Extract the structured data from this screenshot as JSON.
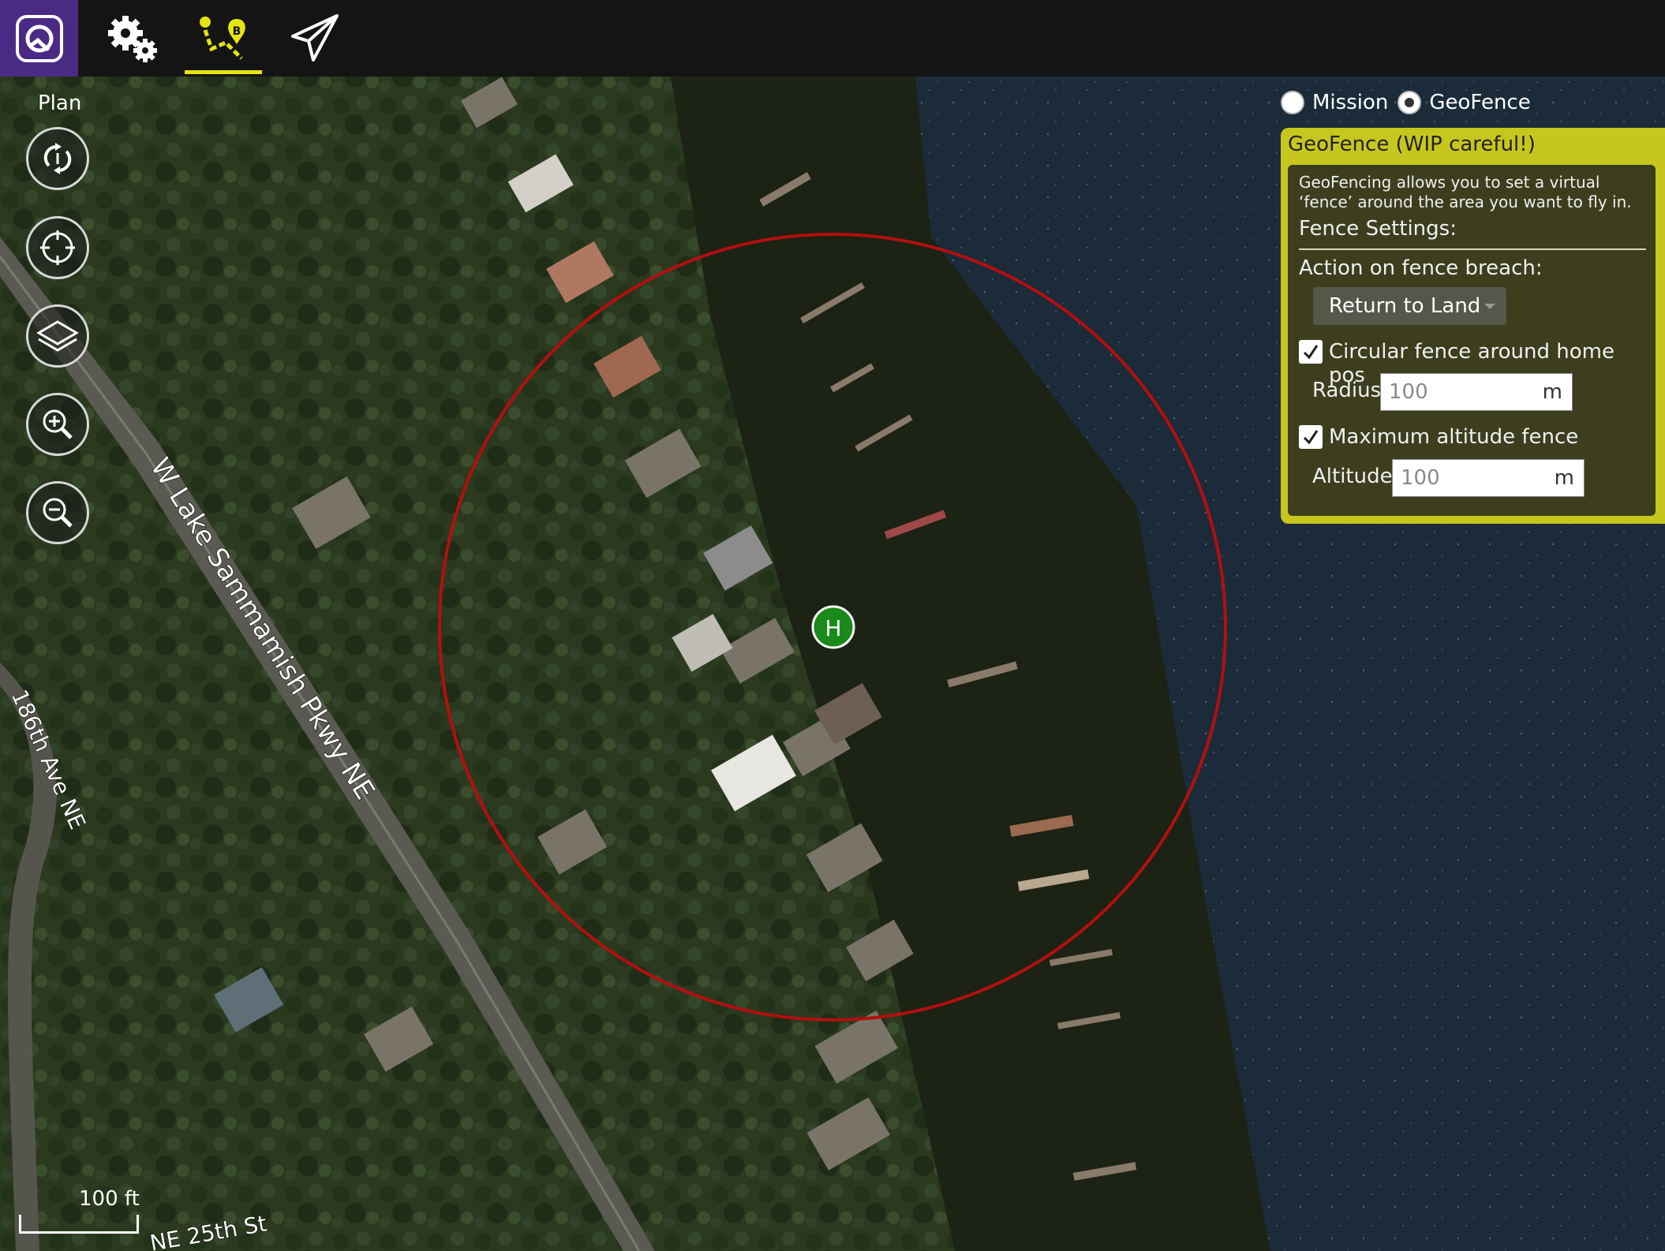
{
  "toolbar": {
    "items": [
      {
        "name": "app-logo",
        "icon": "qgroundcontrol-logo-icon"
      },
      {
        "name": "settings",
        "icon": "gears-icon"
      },
      {
        "name": "plan",
        "icon": "plan-route-icon",
        "active": true,
        "icon_marker": "B"
      },
      {
        "name": "fly",
        "icon": "paper-plane-icon"
      }
    ],
    "active_color": "#e4e60f",
    "logo_bg": "#4b2a86"
  },
  "plan": {
    "label": "Plan",
    "tools": [
      {
        "name": "sync-tool",
        "icon": "sync-icon"
      },
      {
        "name": "center-tool",
        "icon": "crosshair-icon"
      },
      {
        "name": "map-type-tool",
        "icon": "layers-icon"
      },
      {
        "name": "zoom-in-tool",
        "icon": "zoom-in-icon"
      },
      {
        "name": "zoom-out-tool",
        "icon": "zoom-out-icon"
      }
    ]
  },
  "map": {
    "road_labels": [
      "W Lake Sammamish Pkwy NE",
      "186th Ave NE",
      "NE 25th St"
    ],
    "home_marker": "H",
    "scale_label": "100 ft",
    "fence_color": "#b30f0f",
    "home_color": "#1a8a1a"
  },
  "mode": {
    "mission_label": "Mission",
    "geofence_label": "GeoFence",
    "selected": "GeoFence"
  },
  "geofence": {
    "title": "GeoFence (WIP careful!)",
    "description": "GeoFencing allows you to set a virtual ‘fence’ around the area you want to fly in.",
    "settings_heading": "Fence Settings:",
    "action_label": "Action on fence breach:",
    "action_value": "Return to Land",
    "circular_label": "Circular fence around home pos",
    "circular_checked": true,
    "radius_label": "Radius:",
    "radius_value": "100",
    "radius_unit": "m",
    "altitude_fence_label": "Maximum altitude fence",
    "altitude_fence_checked": true,
    "altitude_label": "Altitude:",
    "altitude_value": "100",
    "altitude_unit": "m",
    "panel_color": "#c6c61e"
  }
}
